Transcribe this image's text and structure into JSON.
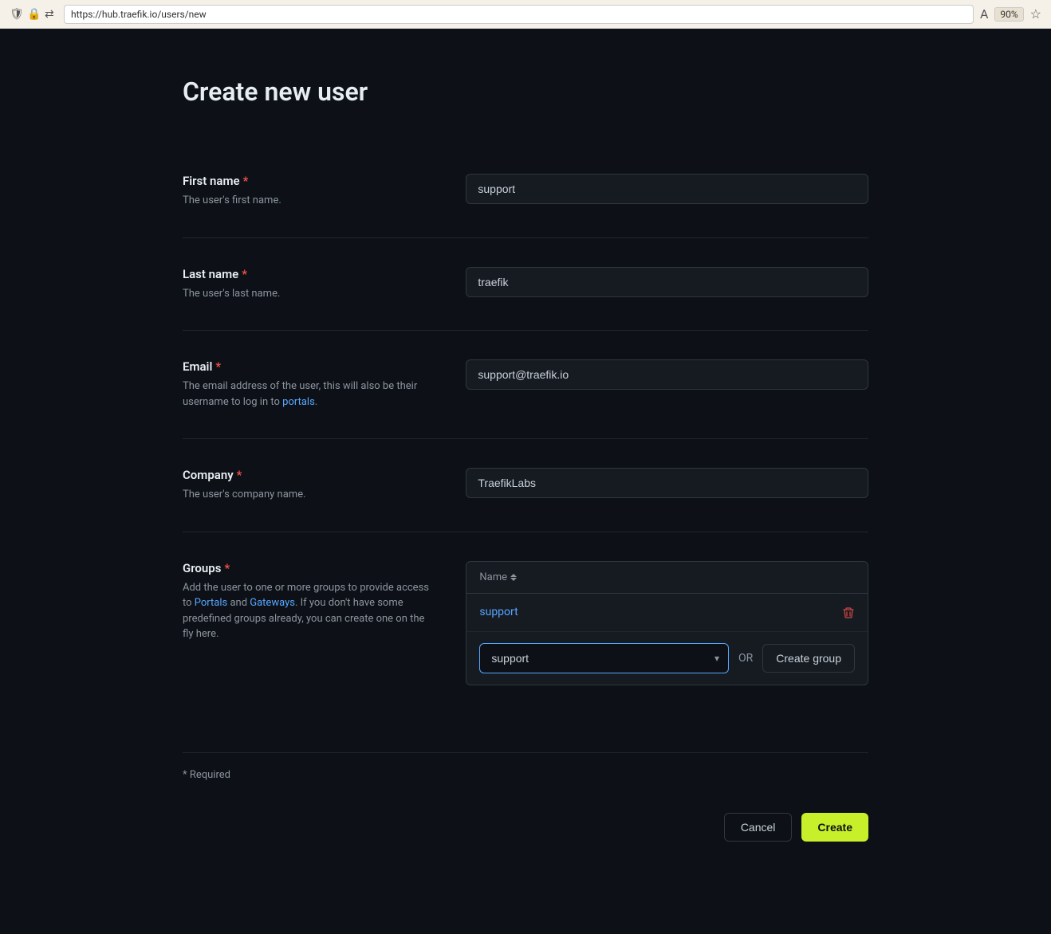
{
  "browser": {
    "url": "https://hub.traefik.io/users/new",
    "zoom": "90%"
  },
  "page": {
    "title": "Create new user"
  },
  "form": {
    "firstName": {
      "label": "First name",
      "required": true,
      "description": "The user's first name.",
      "value": "support",
      "placeholder": ""
    },
    "lastName": {
      "label": "Last name",
      "required": true,
      "description": "The user's last name.",
      "value": "traefik",
      "placeholder": ""
    },
    "email": {
      "label": "Email",
      "required": true,
      "description_prefix": "The email address of the user, this will also be their username to log in to ",
      "description_link": "portals",
      "description_suffix": ".",
      "value": "support@traefik.io",
      "placeholder": ""
    },
    "company": {
      "label": "Company",
      "required": true,
      "description": "The user's company name.",
      "value": "TraefikLabs",
      "placeholder": ""
    },
    "groups": {
      "label": "Groups",
      "required": true,
      "description_prefix": "Add the user to one or more groups to provide access to ",
      "description_link1": "Portals",
      "description_and": " and ",
      "description_link2": "Gateways",
      "description_suffix": ". If you don't have some predefined groups already, you can create one on the fly here.",
      "tableHeader": "Name",
      "existingGroups": [
        {
          "name": "support"
        }
      ],
      "selectValue": "support",
      "selectOptions": [
        "support"
      ],
      "orText": "OR",
      "createGroupLabel": "Create group"
    }
  },
  "footer": {
    "requiredNote": "* Required",
    "cancelLabel": "Cancel",
    "createLabel": "Create"
  }
}
